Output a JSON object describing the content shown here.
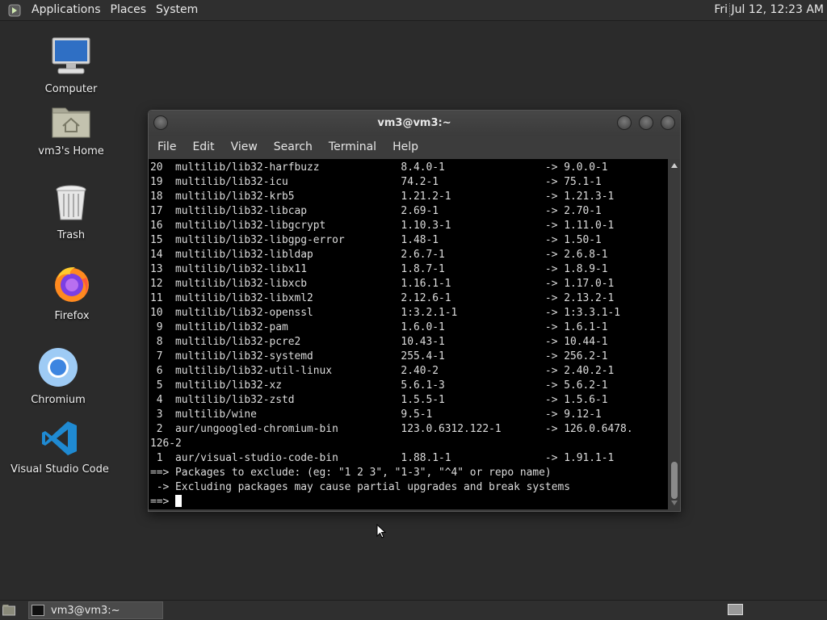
{
  "top_panel": {
    "menus": [
      "Applications",
      "Places",
      "System"
    ],
    "clock": "Fri Jul 12, 12:23 AM"
  },
  "desktop": {
    "icons": [
      {
        "label": "Computer",
        "icon": "computer-icon"
      },
      {
        "label": "vm3's Home",
        "icon": "home-folder-icon"
      },
      {
        "label": "Trash",
        "icon": "trash-icon"
      },
      {
        "label": "Firefox",
        "icon": "firefox-icon"
      },
      {
        "label": "Chromium",
        "icon": "chromium-icon"
      },
      {
        "label": "Visual Studio Code",
        "icon": "vscode-icon"
      }
    ]
  },
  "terminal": {
    "title": "vm3@vm3:~",
    "menus": [
      "File",
      "Edit",
      "View",
      "Search",
      "Terminal",
      "Help"
    ],
    "lines": [
      "20  multilib/lib32-harfbuzz             8.4.0-1                -> 9.0.0-1",
      "19  multilib/lib32-icu                  74.2-1                 -> 75.1-1",
      "18  multilib/lib32-krb5                 1.21.2-1               -> 1.21.3-1",
      "17  multilib/lib32-libcap               2.69-1                 -> 2.70-1",
      "16  multilib/lib32-libgcrypt            1.10.3-1               -> 1.11.0-1",
      "15  multilib/lib32-libgpg-error         1.48-1                 -> 1.50-1",
      "14  multilib/lib32-libldap              2.6.7-1                -> 2.6.8-1",
      "13  multilib/lib32-libx11               1.8.7-1                -> 1.8.9-1",
      "12  multilib/lib32-libxcb               1.16.1-1               -> 1.17.0-1",
      "11  multilib/lib32-libxml2              2.12.6-1               -> 2.13.2-1",
      "10  multilib/lib32-openssl              1:3.2.1-1              -> 1:3.3.1-1",
      " 9  multilib/lib32-pam                  1.6.0-1                -> 1.6.1-1",
      " 8  multilib/lib32-pcre2                10.43-1                -> 10.44-1",
      " 7  multilib/lib32-systemd              255.4-1                -> 256.2-1",
      " 6  multilib/lib32-util-linux           2.40-2                 -> 2.40.2-1",
      " 5  multilib/lib32-xz                   5.6.1-3                -> 5.6.2-1",
      " 4  multilib/lib32-zstd                 1.5.5-1                -> 1.5.6-1",
      " 3  multilib/wine                       9.5-1                  -> 9.12-1",
      " 2  aur/ungoogled-chromium-bin          123.0.6312.122-1       -> 126.0.6478.",
      "126-2",
      " 1  aur/visual-studio-code-bin          1.88.1-1               -> 1.91.1-1",
      "==> Packages to exclude: (eg: \"1 2 3\", \"1-3\", \"^4\" or repo name)",
      " -> Excluding packages may cause partial upgrades and break systems"
    ],
    "prompt": "==> "
  },
  "taskbar": {
    "window_label": "vm3@vm3:~"
  }
}
